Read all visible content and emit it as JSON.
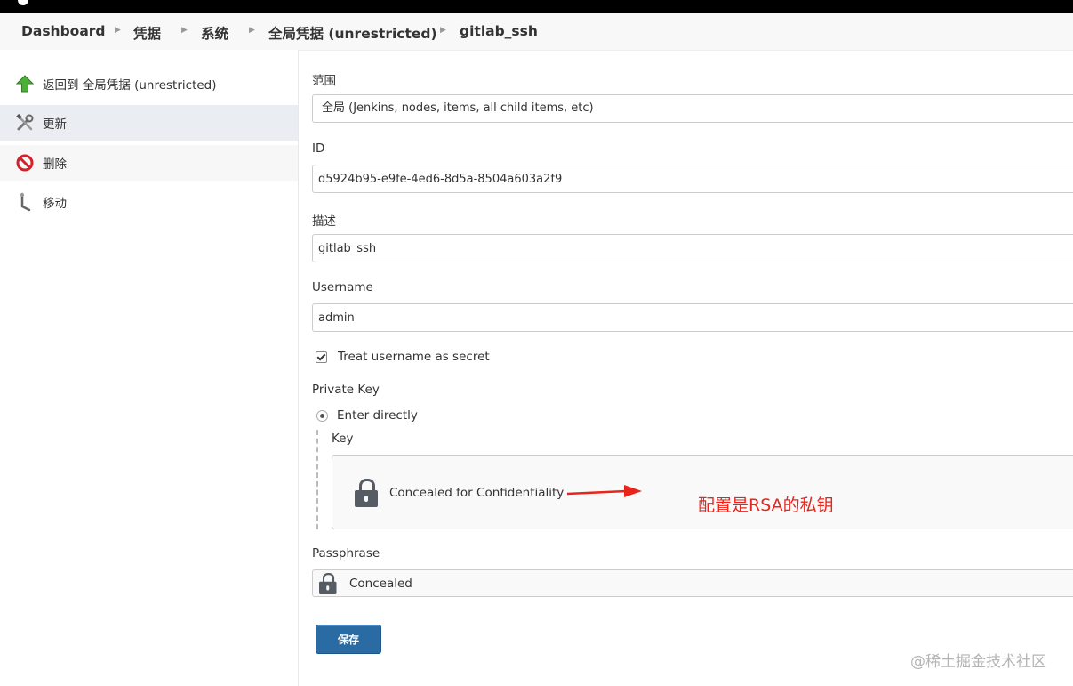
{
  "breadcrumb": [
    {
      "label": "Dashboard"
    },
    {
      "label": "凭据"
    },
    {
      "label": "系统"
    },
    {
      "label": "全局凭据 (unrestricted)"
    },
    {
      "label": "gitlab_ssh"
    }
  ],
  "sidebar": {
    "items": [
      {
        "label": "返回到 全局凭据 (unrestricted)",
        "icon": "up-arrow-icon"
      },
      {
        "label": "更新",
        "icon": "tools-icon"
      },
      {
        "label": "删除",
        "icon": "no-entry-icon"
      },
      {
        "label": "移动",
        "icon": "move-icon"
      }
    ]
  },
  "form": {
    "scope_label": "范围",
    "scope_value": "全局 (Jenkins, nodes, items, all child items, etc)",
    "id_label": "ID",
    "id_value": "d5924b95-e9fe-4ed6-8d5a-8504a603a2f9",
    "description_label": "描述",
    "description_value": "gitlab_ssh",
    "username_label": "Username",
    "username_value": "admin",
    "treat_secret_label": "Treat username as secret",
    "private_key_label": "Private Key",
    "enter_directly_label": "Enter directly",
    "key_label": "Key",
    "key_concealed_text": "Concealed for Confidentiality",
    "passphrase_label": "Passphrase",
    "passphrase_concealed_text": "Concealed",
    "save_label": "保存"
  },
  "annotation": {
    "text": "配置是RSA的私钥",
    "color": "#e8251b"
  },
  "watermark": "@稀土掘金技术社区",
  "colors": {
    "accent": "#2b6ba3",
    "annotation": "#e8251b"
  }
}
